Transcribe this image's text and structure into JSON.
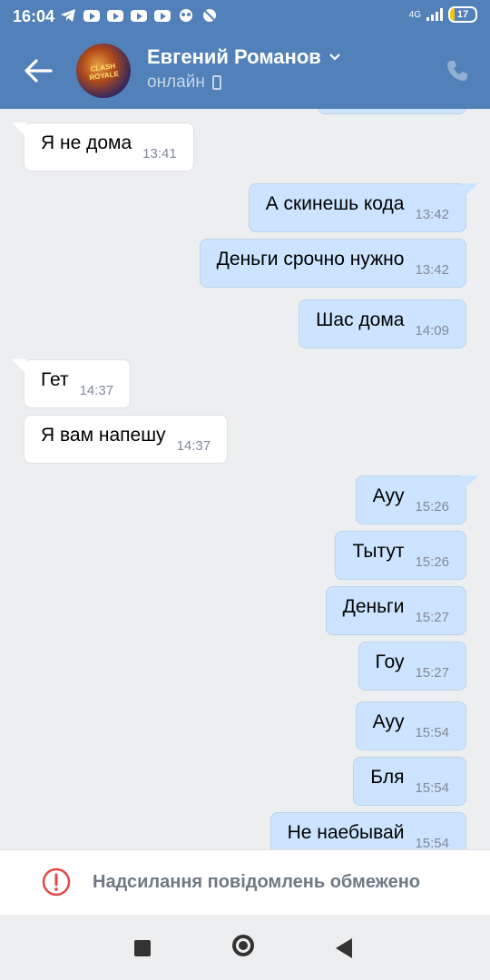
{
  "status_bar": {
    "time": "16:04",
    "network": "4G",
    "battery": "17"
  },
  "header": {
    "name": "Евгений Романов",
    "status": "онлайн",
    "avatar_text": "CLASH ROYALE"
  },
  "messages": [
    {
      "dir": "in",
      "text": "Я не дома",
      "time": "13:41"
    },
    {
      "dir": "out",
      "text": "А скинешь кода",
      "time": "13:42"
    },
    {
      "dir": "out",
      "text": "Деньги срочно нужно",
      "time": "13:42"
    },
    {
      "dir": "out",
      "text": "Шас дома",
      "time": "14:09"
    },
    {
      "dir": "in",
      "text": "Гет",
      "time": "14:37"
    },
    {
      "dir": "in",
      "text": "Я вам напешу",
      "time": "14:37"
    },
    {
      "dir": "out",
      "text": "Ауу",
      "time": "15:26"
    },
    {
      "dir": "out",
      "text": "Тытут",
      "time": "15:26"
    },
    {
      "dir": "out",
      "text": "Деньги",
      "time": "15:27"
    },
    {
      "dir": "out",
      "text": "Гоу",
      "time": "15:27"
    },
    {
      "dir": "out",
      "text": "Ауу",
      "time": "15:54"
    },
    {
      "dir": "out",
      "text": "Бля",
      "time": "15:54"
    },
    {
      "dir": "out",
      "text": "Не наебывай",
      "time": "15:54"
    }
  ],
  "restriction": {
    "text": "Надсилання повідомлень обмежено"
  },
  "colors": {
    "header": "#5181b8",
    "outgoing_bubble": "#cce4ff",
    "incoming_bubble": "#ffffff",
    "background": "#edeef0",
    "warning": "#e64646"
  }
}
